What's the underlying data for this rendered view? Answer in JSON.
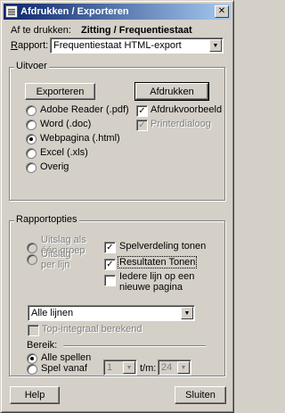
{
  "title": "Afdrukken / Exporteren",
  "header": {
    "print_label": "Af te drukken:",
    "print_value": "Zitting / Frequentiestaat",
    "report_label": "Rapport:",
    "report_value": "Frequentiestaat HTML-export"
  },
  "output": {
    "legend": "Uitvoer",
    "export_button": "Exporteren",
    "print_button": "Afdrukken",
    "formats": [
      {
        "label": "Adobe Reader (.pdf)",
        "checked": false
      },
      {
        "label": "Word (.doc)",
        "checked": false
      },
      {
        "label": "Webpagina (.html)",
        "checked": true
      },
      {
        "label": "Excel (.xls)",
        "checked": false
      },
      {
        "label": "Overig",
        "checked": false
      }
    ],
    "print_preview": {
      "label": "Afdrukvoorbeeld",
      "checked": true
    },
    "printer_dialog": {
      "label": "Printerdialoog",
      "checked": true,
      "disabled": true
    }
  },
  "report_options": {
    "legend": "Rapportopties",
    "outcome_group": "Uitslag als één groep",
    "outcome_line": "Uitslag per lijn",
    "game_distribution": {
      "label": "Spelverdeling tonen",
      "checked": true
    },
    "show_results": {
      "label": "Resultaten Tonen",
      "checked": true
    },
    "each_line_new_page": {
      "label": "Iedere lijn op een nieuwe pagina",
      "checked": false
    },
    "lines_select": "Alle lijnen",
    "top_integral": {
      "label": "Top-integraal berekend",
      "checked": false
    },
    "range_label": "Bereik:",
    "all_games": "Alle spellen",
    "game_from": "Spel vanaf",
    "from_value": "1",
    "to_label": "t/m:",
    "to_value": "24"
  },
  "footer": {
    "help_button": "Help",
    "close_button": "Sluiten"
  }
}
